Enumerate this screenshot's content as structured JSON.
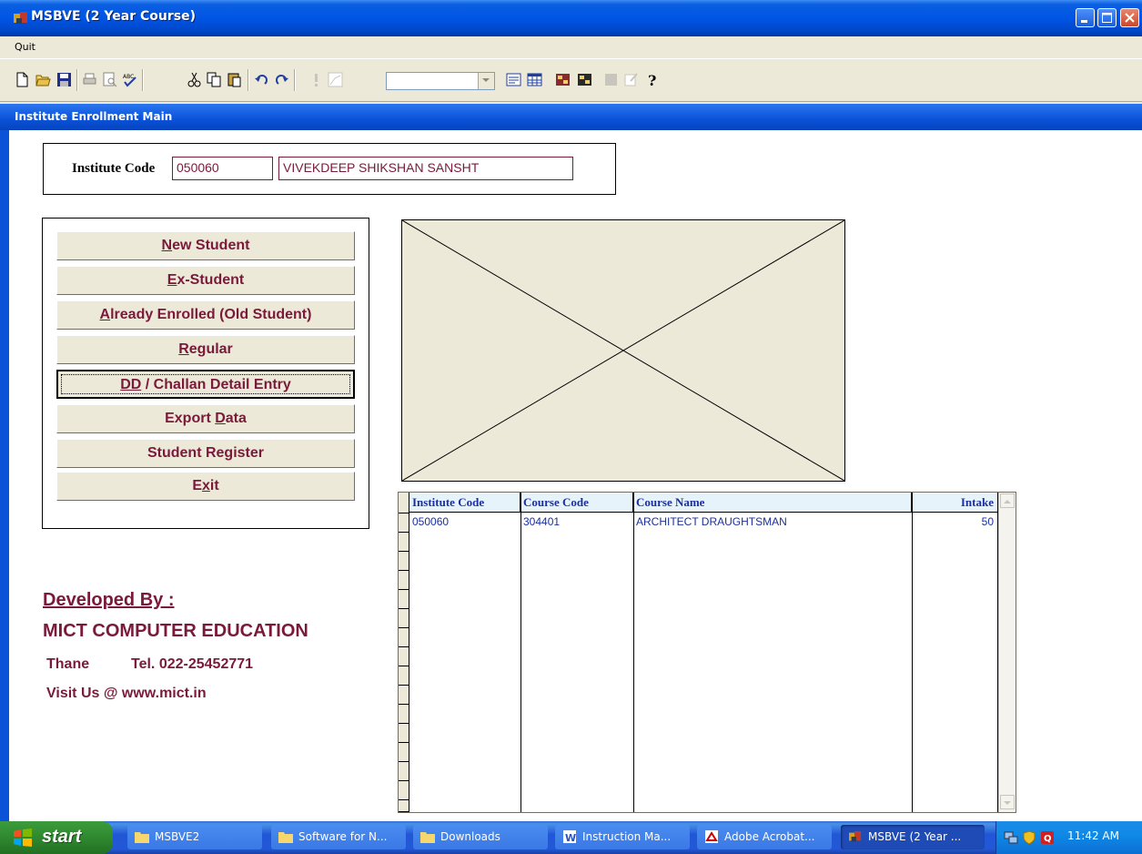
{
  "window": {
    "title": "MSBVE (2 Year Course)"
  },
  "menu": {
    "items": [
      "Quit"
    ]
  },
  "child_window": {
    "title": "Institute Enrollment Main"
  },
  "institute": {
    "label": "Institute Code",
    "code": "050060",
    "name": "VIVEKDEEP SHIKSHAN SANSHT"
  },
  "buttons": [
    {
      "pre": "",
      "key": "N",
      "post": "ew Student"
    },
    {
      "pre": "",
      "key": "E",
      "post": "x-Student"
    },
    {
      "pre": "",
      "key": "A",
      "post": "lready Enrolled (Old Student)"
    },
    {
      "pre": "",
      "key": "R",
      "post": "egular"
    },
    {
      "pre": "",
      "key": "DD",
      "post": " / Challan Detail Entry"
    },
    {
      "pre": "Export ",
      "key": "D",
      "post": "ata"
    },
    {
      "pre": "Student Register",
      "key": "",
      "post": ""
    },
    {
      "pre": "E",
      "key": "x",
      "post": "it"
    }
  ],
  "grid": {
    "columns": [
      "Institute Code",
      "Course Code",
      "Course Name",
      "Intake"
    ],
    "rows": [
      [
        "050060",
        "304401",
        "ARCHITECT DRAUGHTSMAN",
        "50"
      ]
    ]
  },
  "developer": {
    "heading": "Developed By :",
    "company": "MICT COMPUTER EDUCATION",
    "city": "Thane",
    "tel": "Tel. 022-25452771",
    "visit": "Visit Us @ www.mict.in"
  },
  "taskbar": {
    "start": "start",
    "tasks": [
      "MSBVE2",
      "Software for N...",
      "Downloads",
      "Instruction Ma...",
      "Adobe Acrobat...",
      "MSBVE (2 Year ..."
    ],
    "clock": "11:42 AM"
  },
  "colors": {
    "accent_text": "#7a1a3a",
    "grid_text": "#1a2fa0",
    "title_blue": "#0055e5"
  }
}
